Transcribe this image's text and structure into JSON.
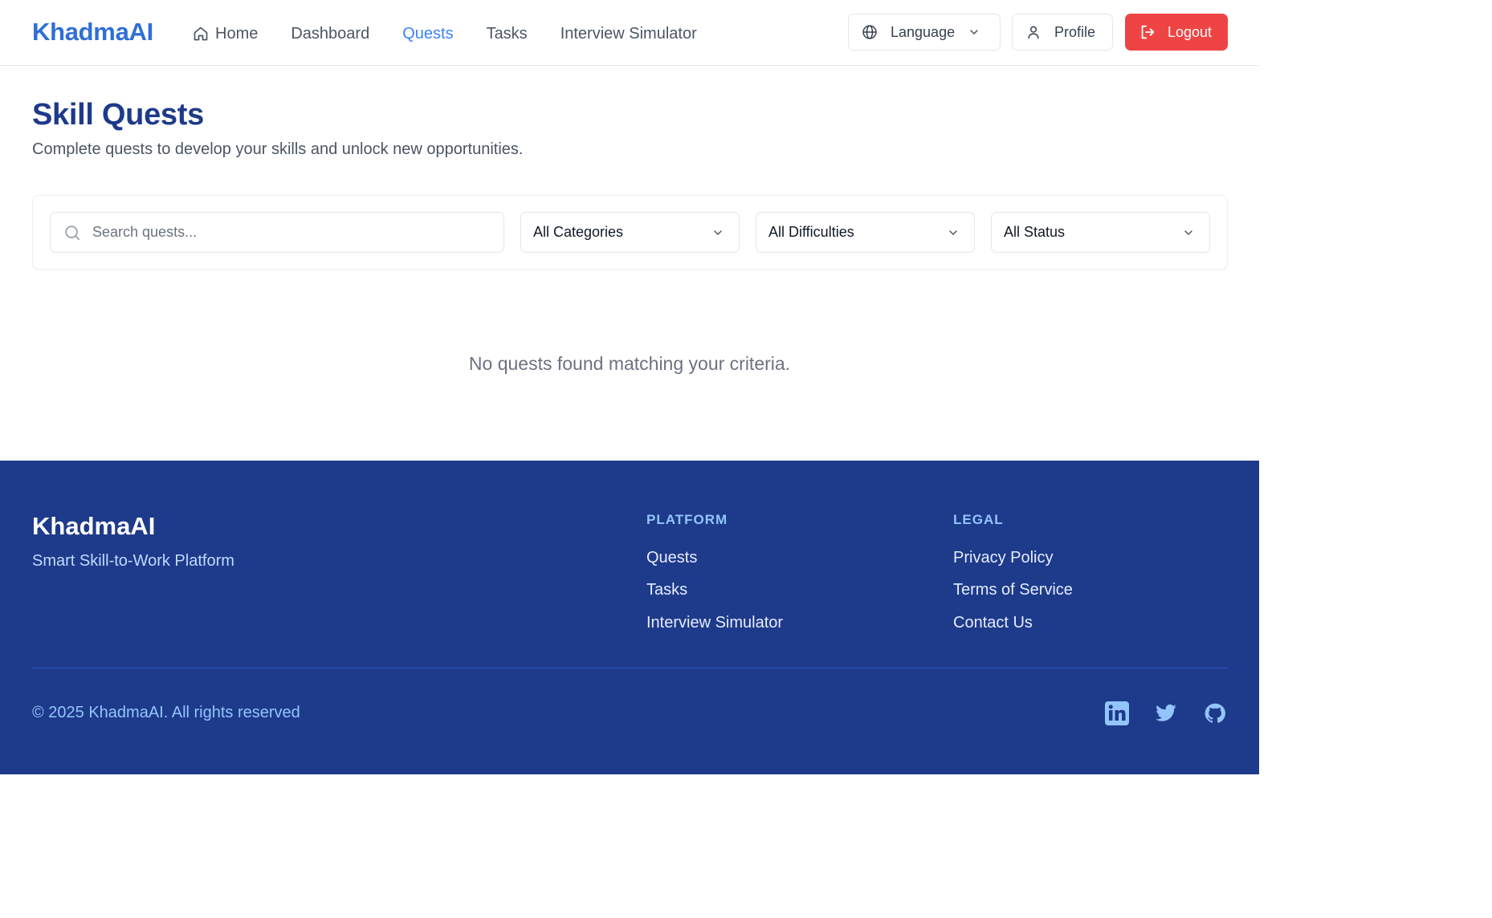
{
  "header": {
    "brand": "KhadmaAI",
    "nav": [
      {
        "label": "Home",
        "icon": "home-icon"
      },
      {
        "label": "Dashboard"
      },
      {
        "label": "Quests",
        "active": true
      },
      {
        "label": "Tasks"
      },
      {
        "label": "Interview Simulator"
      }
    ],
    "language_label": "Language",
    "profile_label": "Profile",
    "logout_label": "Logout"
  },
  "main": {
    "title": "Skill Quests",
    "subtitle": "Complete quests to develop your skills and unlock new opportunities.",
    "search": {
      "placeholder": "Search quests...",
      "value": ""
    },
    "filters": {
      "category": "All Categories",
      "difficulty": "All Difficulties",
      "status": "All Status"
    },
    "empty_message": "No quests found matching your criteria."
  },
  "footer": {
    "brand": "KhadmaAI",
    "tagline": "Smart Skill-to-Work Platform",
    "platform": {
      "title": "PLATFORM",
      "links": [
        "Quests",
        "Tasks",
        "Interview Simulator"
      ]
    },
    "legal": {
      "title": "LEGAL",
      "links": [
        "Privacy Policy",
        "Terms of Service",
        "Contact Us"
      ]
    },
    "copyright": "© 2025 KhadmaAI. All rights reserved",
    "social": [
      "linkedin-icon",
      "twitter-icon",
      "github-icon"
    ]
  },
  "colors": {
    "brand": "#2f6fd6",
    "active_nav": "#3b82f6",
    "title": "#1e3a8a",
    "logout": "#ef4444",
    "footer_bg": "#1e3a8a"
  }
}
